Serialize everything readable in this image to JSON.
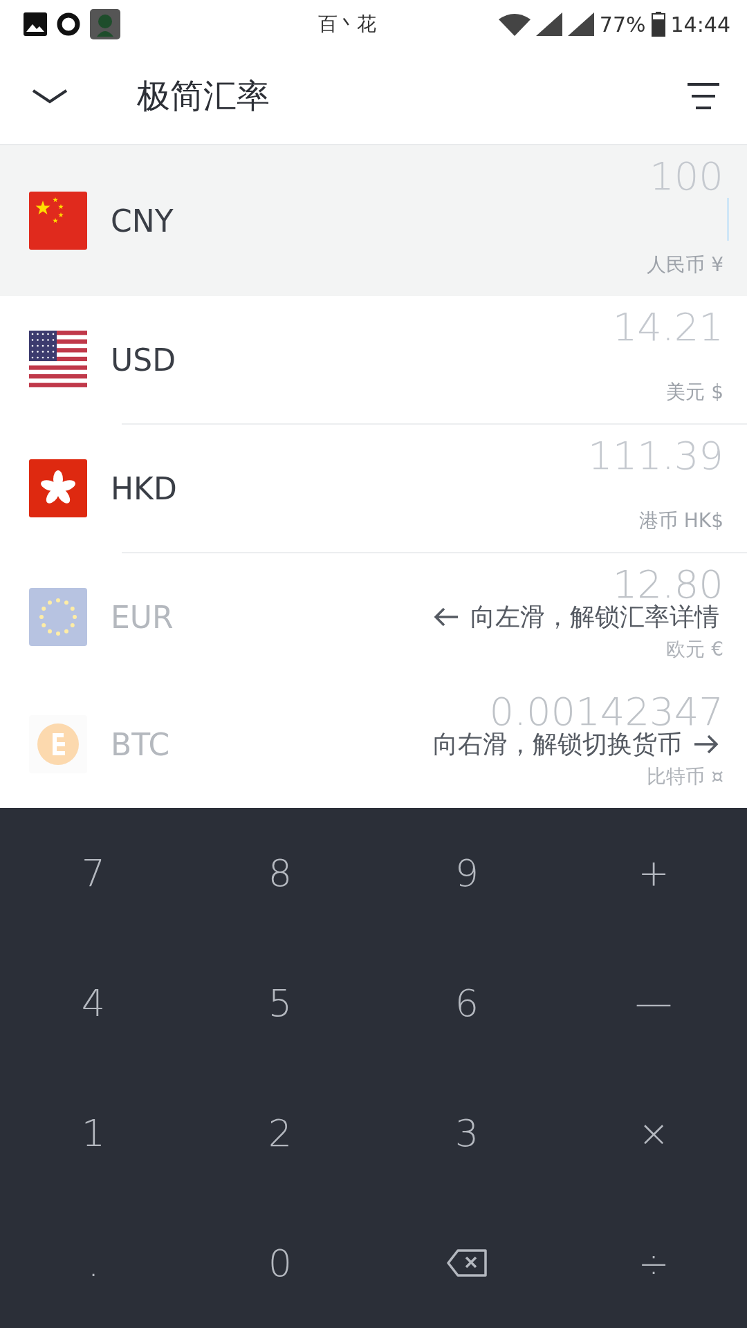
{
  "status_bar": {
    "carrier": "百丶花",
    "battery": "77%",
    "time": "14:44"
  },
  "header": {
    "title": "极简汇率"
  },
  "currencies": [
    {
      "kind": "cn",
      "code": "CNY",
      "amount": "100",
      "name": "人民币 ¥",
      "selected": true,
      "faded": false
    },
    {
      "kind": "us",
      "code": "USD",
      "amount": "14.21",
      "name": "美元 $",
      "selected": false,
      "faded": false
    },
    {
      "kind": "hk",
      "code": "HKD",
      "amount": "111.39",
      "name": "港币 HK$",
      "selected": false,
      "faded": false
    },
    {
      "kind": "eu",
      "code": "EUR",
      "amount": "12.80",
      "name": "欧元 €",
      "selected": false,
      "faded": true,
      "hint": {
        "text": "向左滑，解锁汇率详情",
        "kind": "left"
      }
    },
    {
      "kind": "btc",
      "code": "BTC",
      "amount": "0.00142347",
      "name": "比特币 ¤",
      "selected": false,
      "faded": true,
      "hint": {
        "text": "向右滑，解锁切换货币",
        "kind": "right"
      }
    }
  ],
  "keypad": [
    {
      "kind": "digit",
      "label": "7"
    },
    {
      "kind": "digit",
      "label": "8"
    },
    {
      "kind": "digit",
      "label": "9"
    },
    {
      "kind": "operator",
      "label": "+"
    },
    {
      "kind": "digit",
      "label": "4"
    },
    {
      "kind": "digit",
      "label": "5"
    },
    {
      "kind": "digit",
      "label": "6"
    },
    {
      "kind": "operator",
      "label": "—"
    },
    {
      "kind": "digit",
      "label": "1"
    },
    {
      "kind": "digit",
      "label": "2"
    },
    {
      "kind": "digit",
      "label": "3"
    },
    {
      "kind": "operator",
      "label": "×"
    },
    {
      "kind": "digit",
      "label": "."
    },
    {
      "kind": "digit",
      "label": "0"
    },
    {
      "kind": "backspace"
    },
    {
      "kind": "operator",
      "label": "÷"
    }
  ]
}
